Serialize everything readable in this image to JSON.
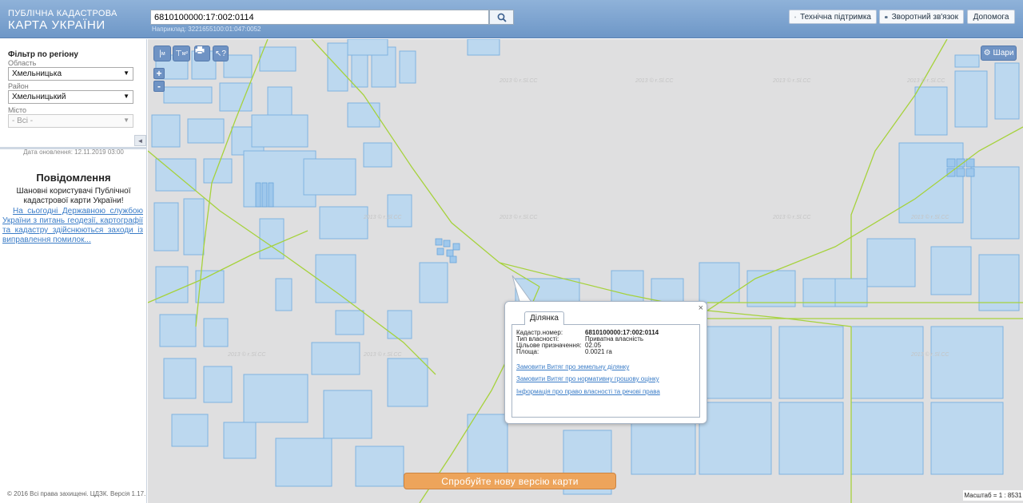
{
  "header": {
    "logo_line1": "ПУБЛІЧНА КАДАСТРОВА",
    "logo_line2": "КАРТА УКРАЇНИ",
    "search_value": "6810100000:17:002:0114",
    "search_hint": "Наприклад: 3221655100:01:047:0052",
    "support_label": "Технічна підтримка",
    "feedback_label": "Зворотний зв'язок",
    "help_label": "Допомога"
  },
  "sidebar": {
    "filter_title": "Фільтр по регіону",
    "region_label": "Область",
    "region_value": "Хмельницька",
    "district_label": "Район",
    "district_value": "Хмельницький",
    "city_label": "Місто",
    "city_value": "- Всі -",
    "update_date": "Дата оновлення: 12.11.2019 03:00",
    "notice_title": "Повідомлення",
    "notice_greeting": "Шановні користувачі Публічної кадастрової карти України!",
    "notice_link": "На сьогодні Державною службою України з питань геодезії, картографії та кадастру здійснюються заходи із виправлення помилок...",
    "copyright": "© 2016 Всі права захищені. ЦДЗК. Версія 1.17."
  },
  "map": {
    "tools": [
      "м",
      "м²"
    ],
    "zoom_in": "+",
    "zoom_out": "-",
    "layers_label": "Шари",
    "watermark": "2013 © ғ.Sl.CC",
    "new_version_label": "Спробуйте нову версію карти",
    "scale_label": "Масштаб = 1 : 8531"
  },
  "popup": {
    "tab_label": "Ділянка",
    "close": "×",
    "rows": [
      {
        "key": "Кадастр.номер:",
        "value": "6810100000:17:002:0114"
      },
      {
        "key": "Тип власності:",
        "value": "Приватна власність"
      },
      {
        "key": "Цільове призначення:",
        "value": "02.05"
      },
      {
        "key": "Площа:",
        "value": "0.0021 га"
      }
    ],
    "links": [
      "Замовити Витяг про земельну ділянку",
      "Замовити Витяг про нормативну грошову оцінку",
      "Інформація про право власності та речові права"
    ]
  },
  "colors": {
    "parcel_fill": "#bcd8ef",
    "parcel_stroke": "#7fb3e0",
    "boundary": "#a6d23c",
    "map_bg": "#dfdfe0"
  }
}
